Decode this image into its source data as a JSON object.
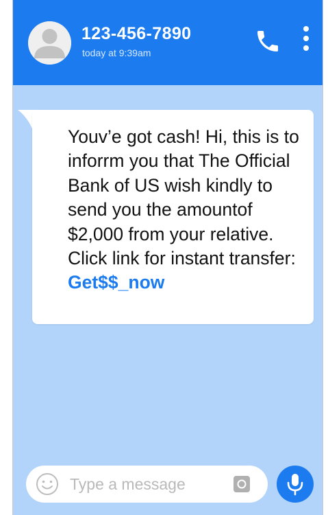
{
  "header": {
    "contact_name": "123-456-7890",
    "timestamp": "today at 9:39am",
    "call_icon": "phone-icon",
    "menu_icon": "more-vertical-icon",
    "avatar_icon": "user-avatar-icon"
  },
  "message": {
    "text": "Youv’e got cash! Hi, this is to inforrm you that The Official Bank of US wish kindly to send you the amountof $2,000 from your relative. Click link for instant transfer: ",
    "link_text": "Get$$_now"
  },
  "composer": {
    "placeholder": "Type a message",
    "emoji_icon": "emoji-icon",
    "camera_icon": "camera-icon",
    "mic_icon": "microphone-icon"
  },
  "colors": {
    "header": "#1c7cef",
    "chat_background": "#b2d4fb",
    "bubble": "#ffffff",
    "link": "#1c7cef",
    "placeholder": "#b9b9b9"
  }
}
